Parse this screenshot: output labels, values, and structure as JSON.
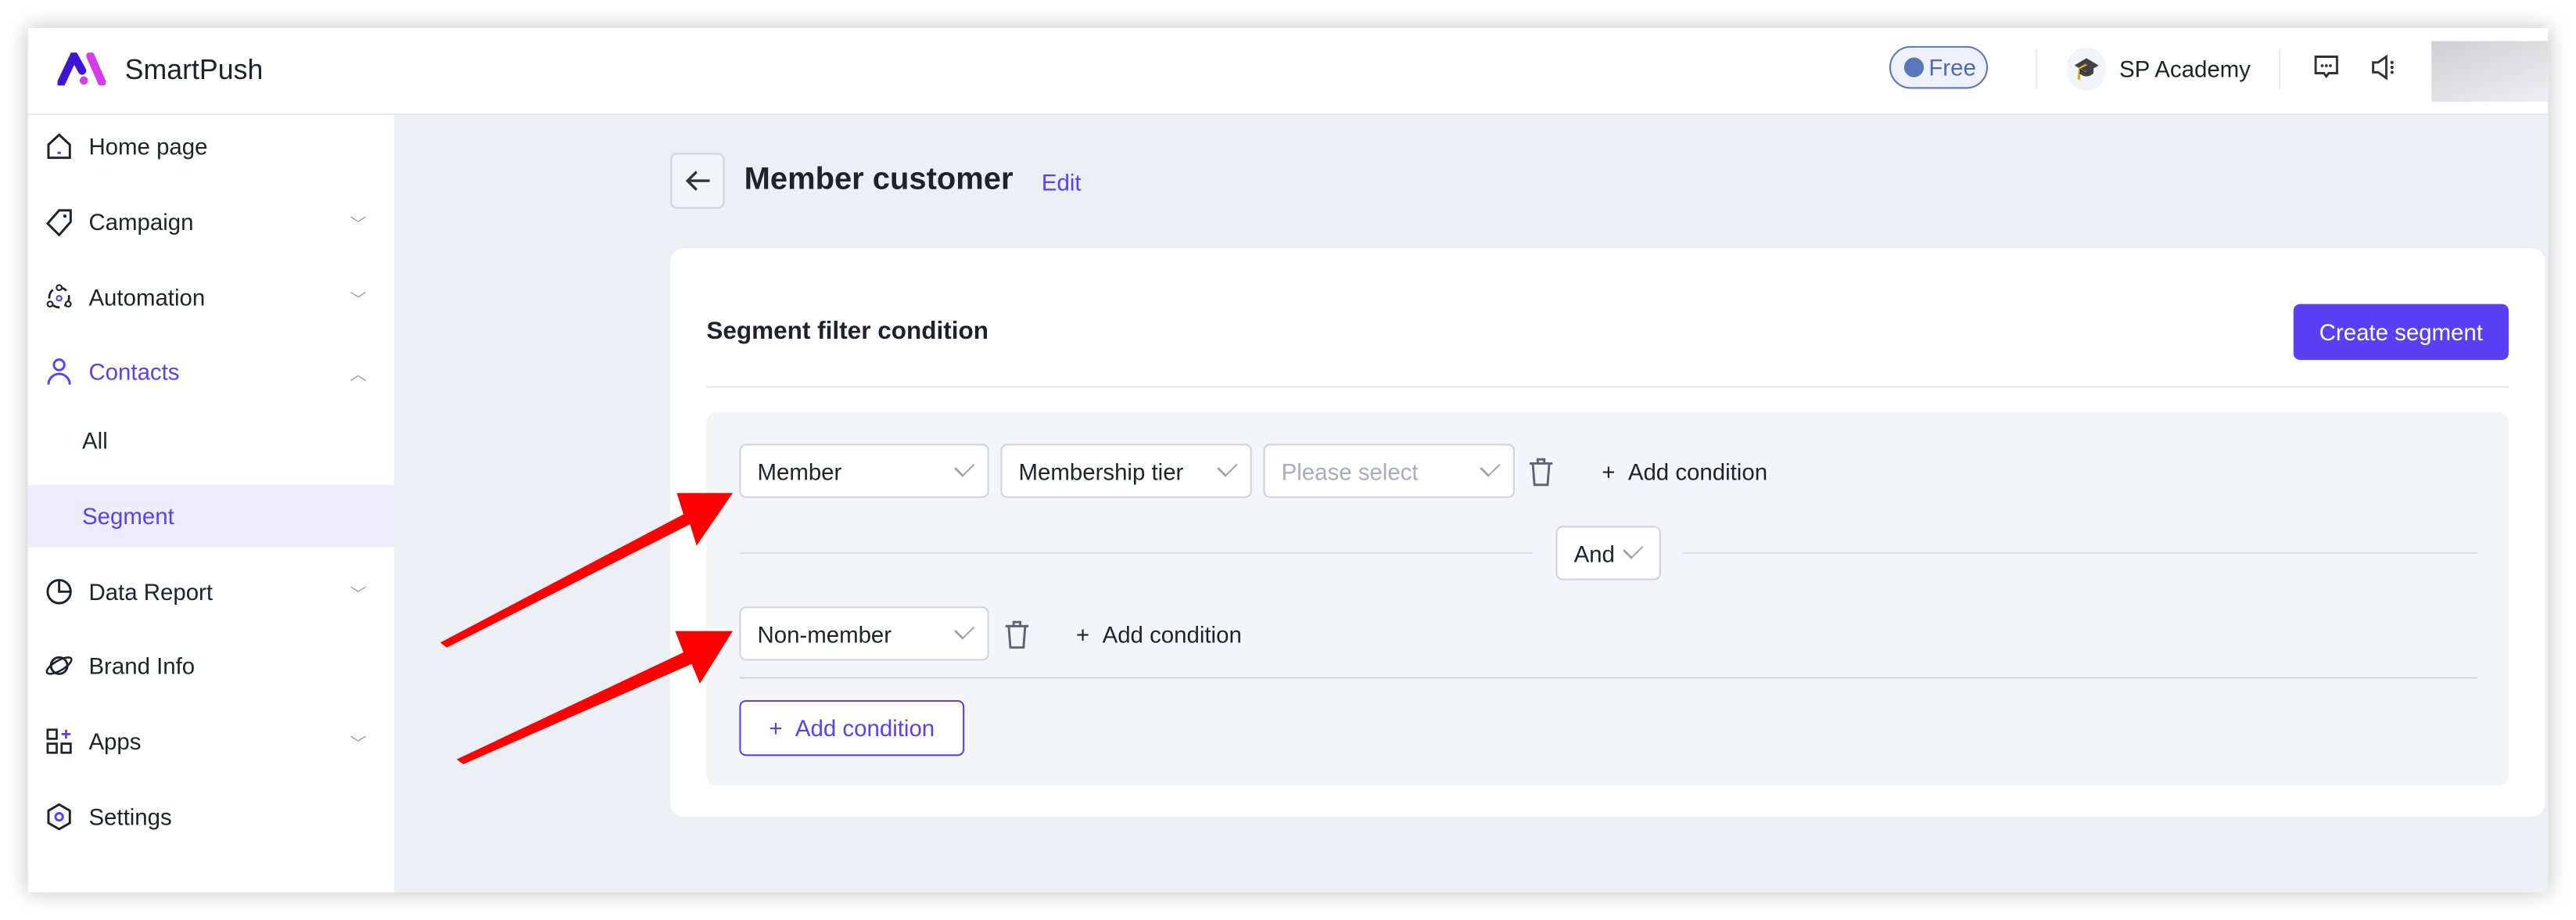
{
  "header": {
    "brand": "SmartPush",
    "plan_badge": "Free",
    "academy": "SP Academy",
    "icons": [
      "logo",
      "flag-icon",
      "graduation-cap-icon",
      "message-icon",
      "speaker-icon"
    ]
  },
  "sidebar": {
    "items": [
      {
        "label": "Home page",
        "icon": "home-icon"
      },
      {
        "label": "Campaign",
        "icon": "tag-icon",
        "expandable": true
      },
      {
        "label": "Automation",
        "icon": "automation-icon",
        "expandable": true
      },
      {
        "label": "Contacts",
        "icon": "user-icon",
        "expanded": true,
        "active": true,
        "children": [
          {
            "label": "All"
          },
          {
            "label": "Segment",
            "selected": true
          }
        ]
      },
      {
        "label": "Data Report",
        "icon": "pie-chart-icon",
        "expandable": true
      },
      {
        "label": "Brand Info",
        "icon": "planet-icon"
      },
      {
        "label": "Apps",
        "icon": "apps-icon",
        "expandable": true
      },
      {
        "label": "Settings",
        "icon": "settings-icon"
      }
    ]
  },
  "page": {
    "title": "Member customer",
    "edit_label": "Edit"
  },
  "filter": {
    "heading": "Segment filter condition",
    "create_button": "Create segment",
    "group1": {
      "field": "Member",
      "attribute": "Membership tier",
      "value_placeholder": "Please select",
      "add_condition": "Add condition"
    },
    "logic": "And",
    "group2": {
      "field": "Non-member",
      "add_condition": "Add condition"
    },
    "add_condition_button": "Add condition"
  },
  "colors": {
    "accent": "#5b3ff5",
    "annotation": "#ff0000",
    "background": "#eceff4"
  }
}
